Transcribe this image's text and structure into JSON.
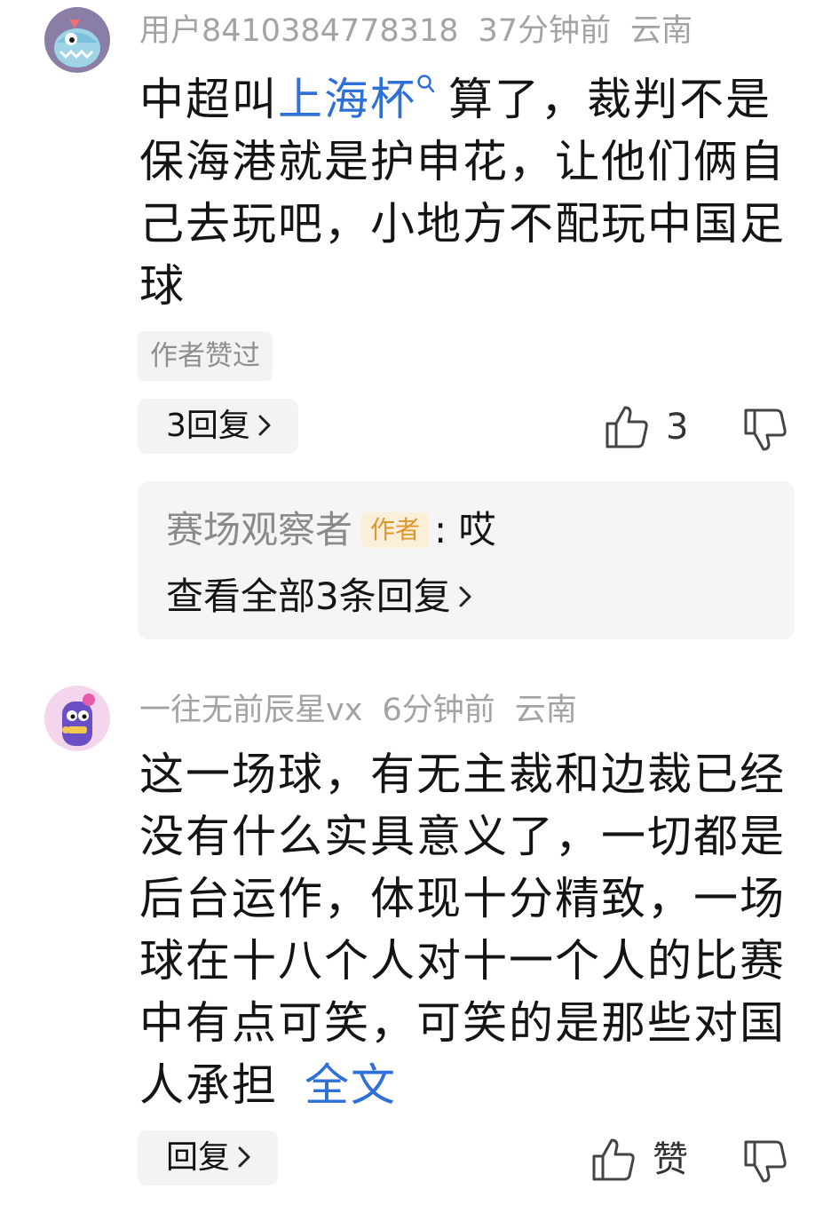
{
  "comments": [
    {
      "username": "用户8410384778318",
      "time": "37分钟前",
      "location": "云南",
      "text_before_link": "中超叫",
      "link_word": "上海杯",
      "text_after_link": "算了，裁判不是保海港就是护申花，让他们俩自己去玩吧，小地方不配玩中国足球",
      "tag": "作者赞过",
      "reply_button": "3回复",
      "like_count": "3",
      "reply_preview": {
        "user": "赛场观察者",
        "badge": "作者",
        "text": ": 哎",
        "view_all": "查看全部3条回复"
      }
    },
    {
      "username": "一往无前辰星vx",
      "time": "6分钟前",
      "location": "云南",
      "text": "这一场球，有无主裁和边裁已经没有什么实具意义了，一切都是后台运作，体现十分精致，一场球在十八个人对十一个人的比赛中有点可笑，可笑的是那些对国人承担",
      "fulltext_label": "全文",
      "reply_button": "回复",
      "like_label": "赞"
    }
  ],
  "icons": {
    "avatar1": "shark-monster-avatar",
    "avatar2": "purple-creature-avatar",
    "like": "thumbs-up-icon",
    "dislike": "thumbs-down-icon",
    "search": "search-icon",
    "chevron": "chevron-right-icon"
  },
  "colors": {
    "link": "#2e6fd8",
    "meta": "#a3a3a3",
    "chip_bg": "#f3f3f3",
    "badge_bg": "#fbefd9",
    "badge_text": "#e0962c"
  }
}
